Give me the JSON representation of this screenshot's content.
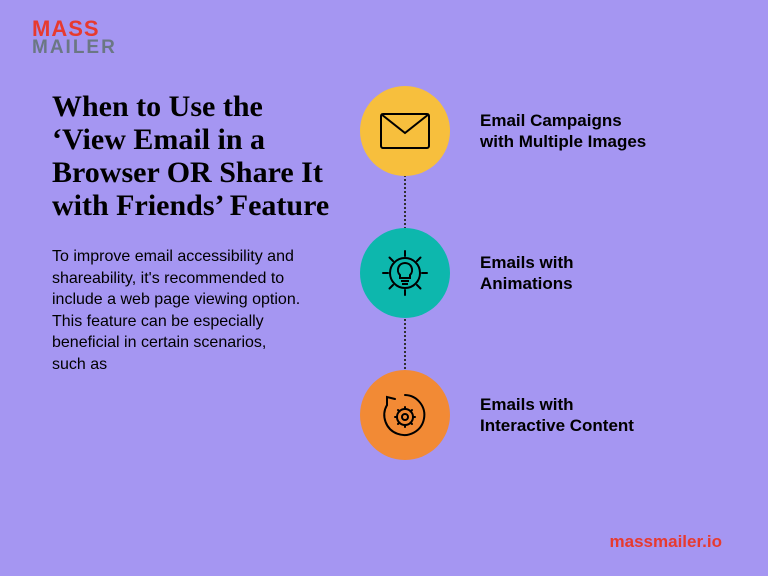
{
  "logo": {
    "top": "MASS",
    "bottom": "MAILER"
  },
  "heading": "When to Use the ‘View Email in a Browser OR Share It with Friends’ Feature",
  "body": "To improve email accessibility and shareability, it's recommended to include a web page viewing option. This feature can be especially beneficial in certain scenarios, such as",
  "items": [
    {
      "label": "Email Campaigns with Multiple Images",
      "icon": "envelope-icon",
      "color": "#f7bf3d"
    },
    {
      "label": "Emails with Animations",
      "icon": "gear-bulb-icon",
      "color": "#0db7ad"
    },
    {
      "label": "Emails with Interactive Content",
      "icon": "gear-cycle-icon",
      "color": "#f28a35"
    }
  ],
  "footer": "massmailer.io"
}
